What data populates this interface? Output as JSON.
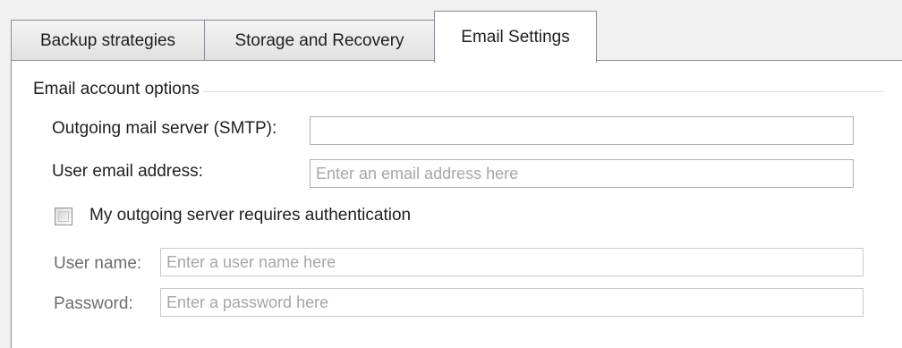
{
  "tabs": [
    {
      "label": "Backup strategies",
      "active": false
    },
    {
      "label": "Storage and Recovery",
      "active": false
    },
    {
      "label": "Email Settings",
      "active": true
    }
  ],
  "group": {
    "title": "Email account options"
  },
  "smtp": {
    "label": "Outgoing mail server (SMTP):",
    "value": "",
    "placeholder": ""
  },
  "email": {
    "label": "User email address:",
    "value": "",
    "placeholder": "Enter an email address here"
  },
  "auth": {
    "label": "My outgoing server requires authentication",
    "checked": false
  },
  "username": {
    "label": "User name:",
    "value": "",
    "placeholder": "Enter a user name here",
    "enabled": false
  },
  "password": {
    "label": "Password:",
    "value": "",
    "placeholder": "Enter a password here",
    "enabled": false
  },
  "colors": {
    "border": "#898c95",
    "disabled_text": "#6d6d6d",
    "placeholder_text": "#a6a6a6"
  }
}
